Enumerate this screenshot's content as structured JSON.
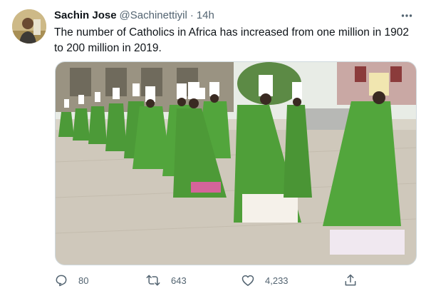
{
  "tweet": {
    "author": {
      "display_name": "Sachin Jose",
      "handle": "@Sachinettiyil",
      "separator": "·",
      "time": "14h",
      "avatar_icon": "user-avatar"
    },
    "text": "The number of Catholics in Africa has increased from one million in 1902 to 200 million in 2019.",
    "media": {
      "icon": "photo-procession-of-bishops-in-green-vestments"
    },
    "actions": {
      "reply": {
        "icon": "reply-icon",
        "count": "80"
      },
      "retweet": {
        "icon": "retweet-icon",
        "count": "643"
      },
      "like": {
        "icon": "heart-icon",
        "count": "4,233"
      },
      "share": {
        "icon": "share-icon"
      }
    },
    "colors": {
      "text_primary": "#0f1419",
      "text_secondary": "#536471",
      "border": "#cfd9de",
      "vestment_green": "#4c9a38"
    }
  }
}
